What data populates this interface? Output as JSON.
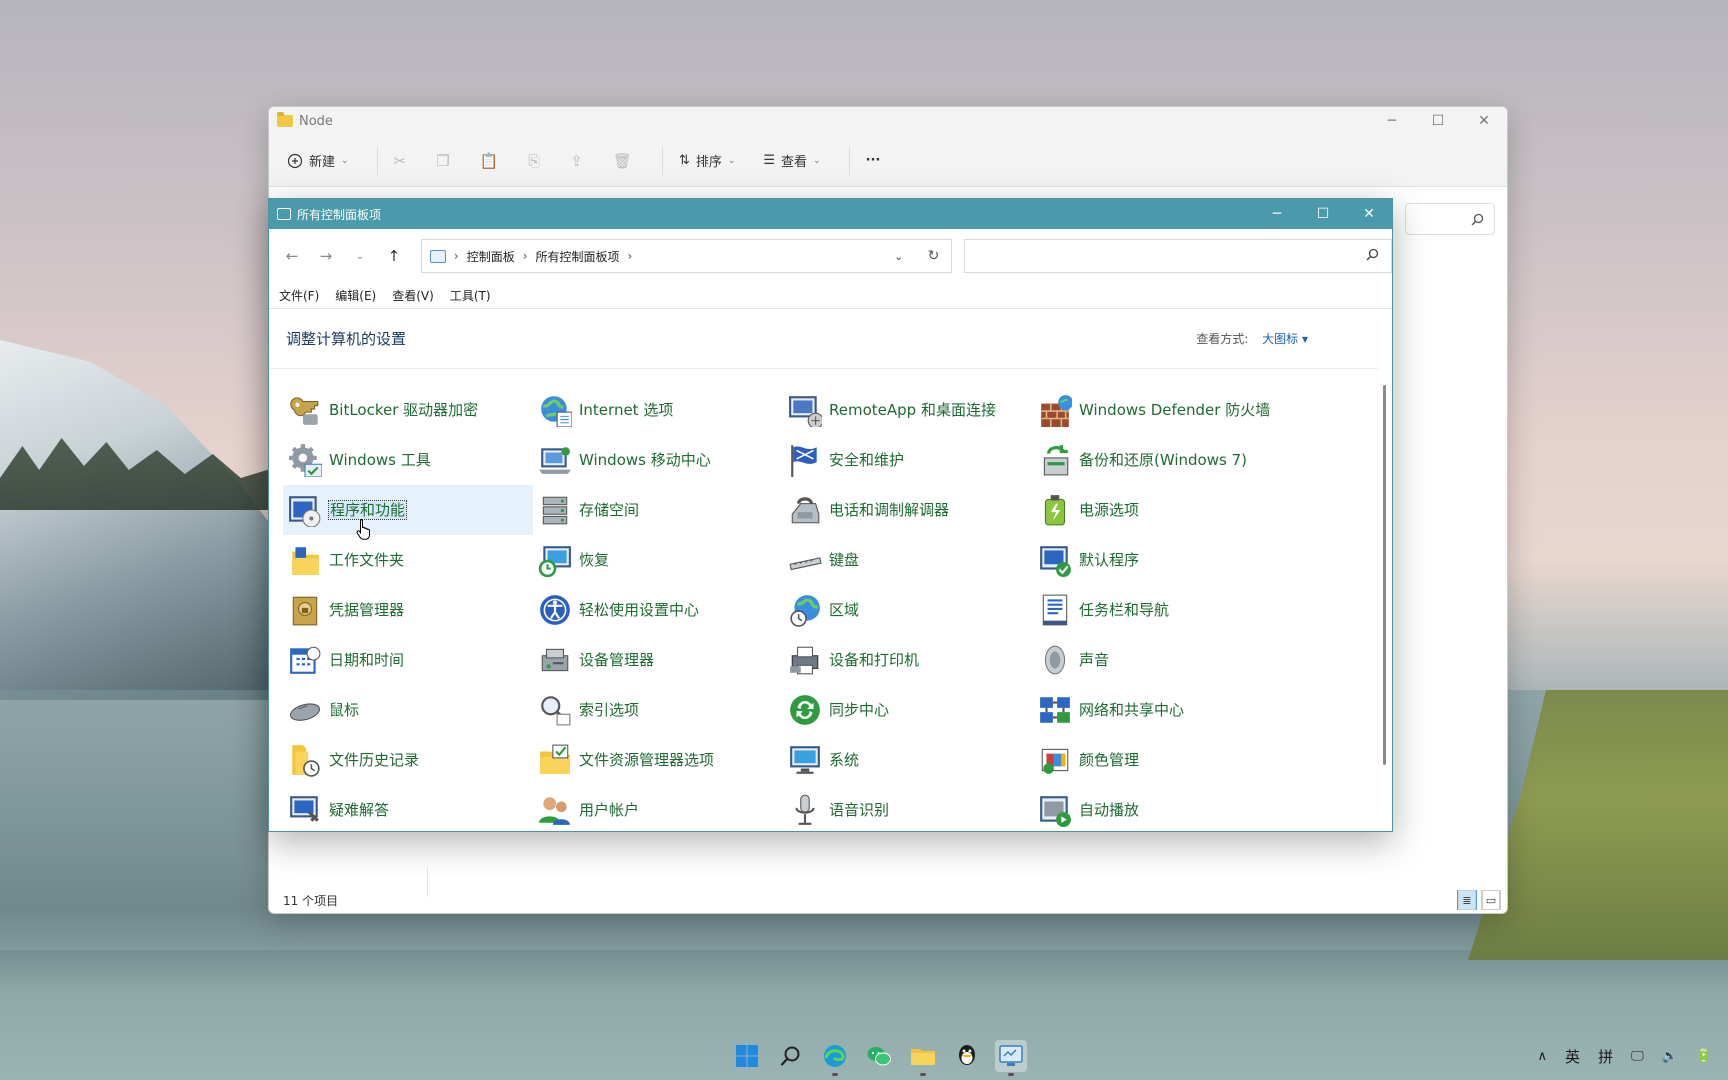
{
  "explorer": {
    "title": "Node",
    "toolbar": {
      "new_label": "新建",
      "sort_label": "排序",
      "view_label": "查看",
      "more_label": "···"
    },
    "status": "11 个项目",
    "controls": {
      "minimize": "─",
      "maximize": "☐",
      "close": "✕"
    }
  },
  "cp": {
    "title": "所有控制面板项",
    "controls": {
      "minimize": "─",
      "maximize": "☐",
      "close": "✕"
    },
    "nav": {
      "back": "←",
      "forward": "→",
      "recent": "⌄",
      "up": "↑"
    },
    "address": {
      "crumbs": [
        "控制面板",
        "所有控制面板项"
      ],
      "sep": "›"
    },
    "search": {
      "placeholder": ""
    },
    "menu": [
      "文件(F)",
      "编辑(E)",
      "查看(V)",
      "工具(T)"
    ],
    "header": {
      "title": "调整计算机的设置",
      "viewby_label": "查看方式:",
      "viewby_value": "大图标 ▾"
    },
    "items": [
      {
        "label": "BitLocker 驱动器加密",
        "icon": "key-icon"
      },
      {
        "label": "Internet 选项",
        "icon": "globe-icon"
      },
      {
        "label": "RemoteApp 和桌面连接",
        "icon": "remote-desktop-icon"
      },
      {
        "label": "Windows Defender 防火墙",
        "icon": "firewall-icon"
      },
      {
        "label": "Windows 工具",
        "icon": "tools-gear-icon"
      },
      {
        "label": "Windows 移动中心",
        "icon": "mobility-icon"
      },
      {
        "label": "安全和维护",
        "icon": "flag-icon"
      },
      {
        "label": "备份和还原(Windows 7)",
        "icon": "backup-icon"
      },
      {
        "label": "程序和功能",
        "icon": "programs-icon",
        "selected": true
      },
      {
        "label": "存储空间",
        "icon": "storage-icon"
      },
      {
        "label": "电话和调制解调器",
        "icon": "phone-icon"
      },
      {
        "label": "电源选项",
        "icon": "power-icon"
      },
      {
        "label": "工作文件夹",
        "icon": "work-folder-icon"
      },
      {
        "label": "恢复",
        "icon": "recovery-icon"
      },
      {
        "label": "键盘",
        "icon": "keyboard-icon"
      },
      {
        "label": "默认程序",
        "icon": "default-programs-icon"
      },
      {
        "label": "凭据管理器",
        "icon": "credential-icon"
      },
      {
        "label": "轻松使用设置中心",
        "icon": "ease-of-access-icon"
      },
      {
        "label": "区域",
        "icon": "region-icon"
      },
      {
        "label": "任务栏和导航",
        "icon": "taskbar-icon"
      },
      {
        "label": "日期和时间",
        "icon": "calendar-icon"
      },
      {
        "label": "设备管理器",
        "icon": "device-manager-icon"
      },
      {
        "label": "设备和打印机",
        "icon": "printer-icon"
      },
      {
        "label": "声音",
        "icon": "speaker-icon"
      },
      {
        "label": "鼠标",
        "icon": "mouse-icon"
      },
      {
        "label": "索引选项",
        "icon": "index-search-icon"
      },
      {
        "label": "同步中心",
        "icon": "sync-icon"
      },
      {
        "label": "网络和共享中心",
        "icon": "network-icon"
      },
      {
        "label": "文件历史记录",
        "icon": "file-history-icon"
      },
      {
        "label": "文件资源管理器选项",
        "icon": "folder-options-icon"
      },
      {
        "label": "系统",
        "icon": "system-icon"
      },
      {
        "label": "颜色管理",
        "icon": "color-management-icon"
      },
      {
        "label": "疑难解答",
        "icon": "troubleshoot-icon"
      },
      {
        "label": "用户帐户",
        "icon": "user-accounts-icon"
      },
      {
        "label": "语音识别",
        "icon": "microphone-icon"
      },
      {
        "label": "自动播放",
        "icon": "autoplay-icon"
      }
    ]
  },
  "taskbar": {
    "apps": [
      "start-icon",
      "search-icon",
      "edge-icon",
      "wechat-icon",
      "file-explorer-icon",
      "qq-icon",
      "control-panel-icon"
    ],
    "tray": {
      "chevron": "∧",
      "lang": "英",
      "ime": "拼"
    }
  }
}
